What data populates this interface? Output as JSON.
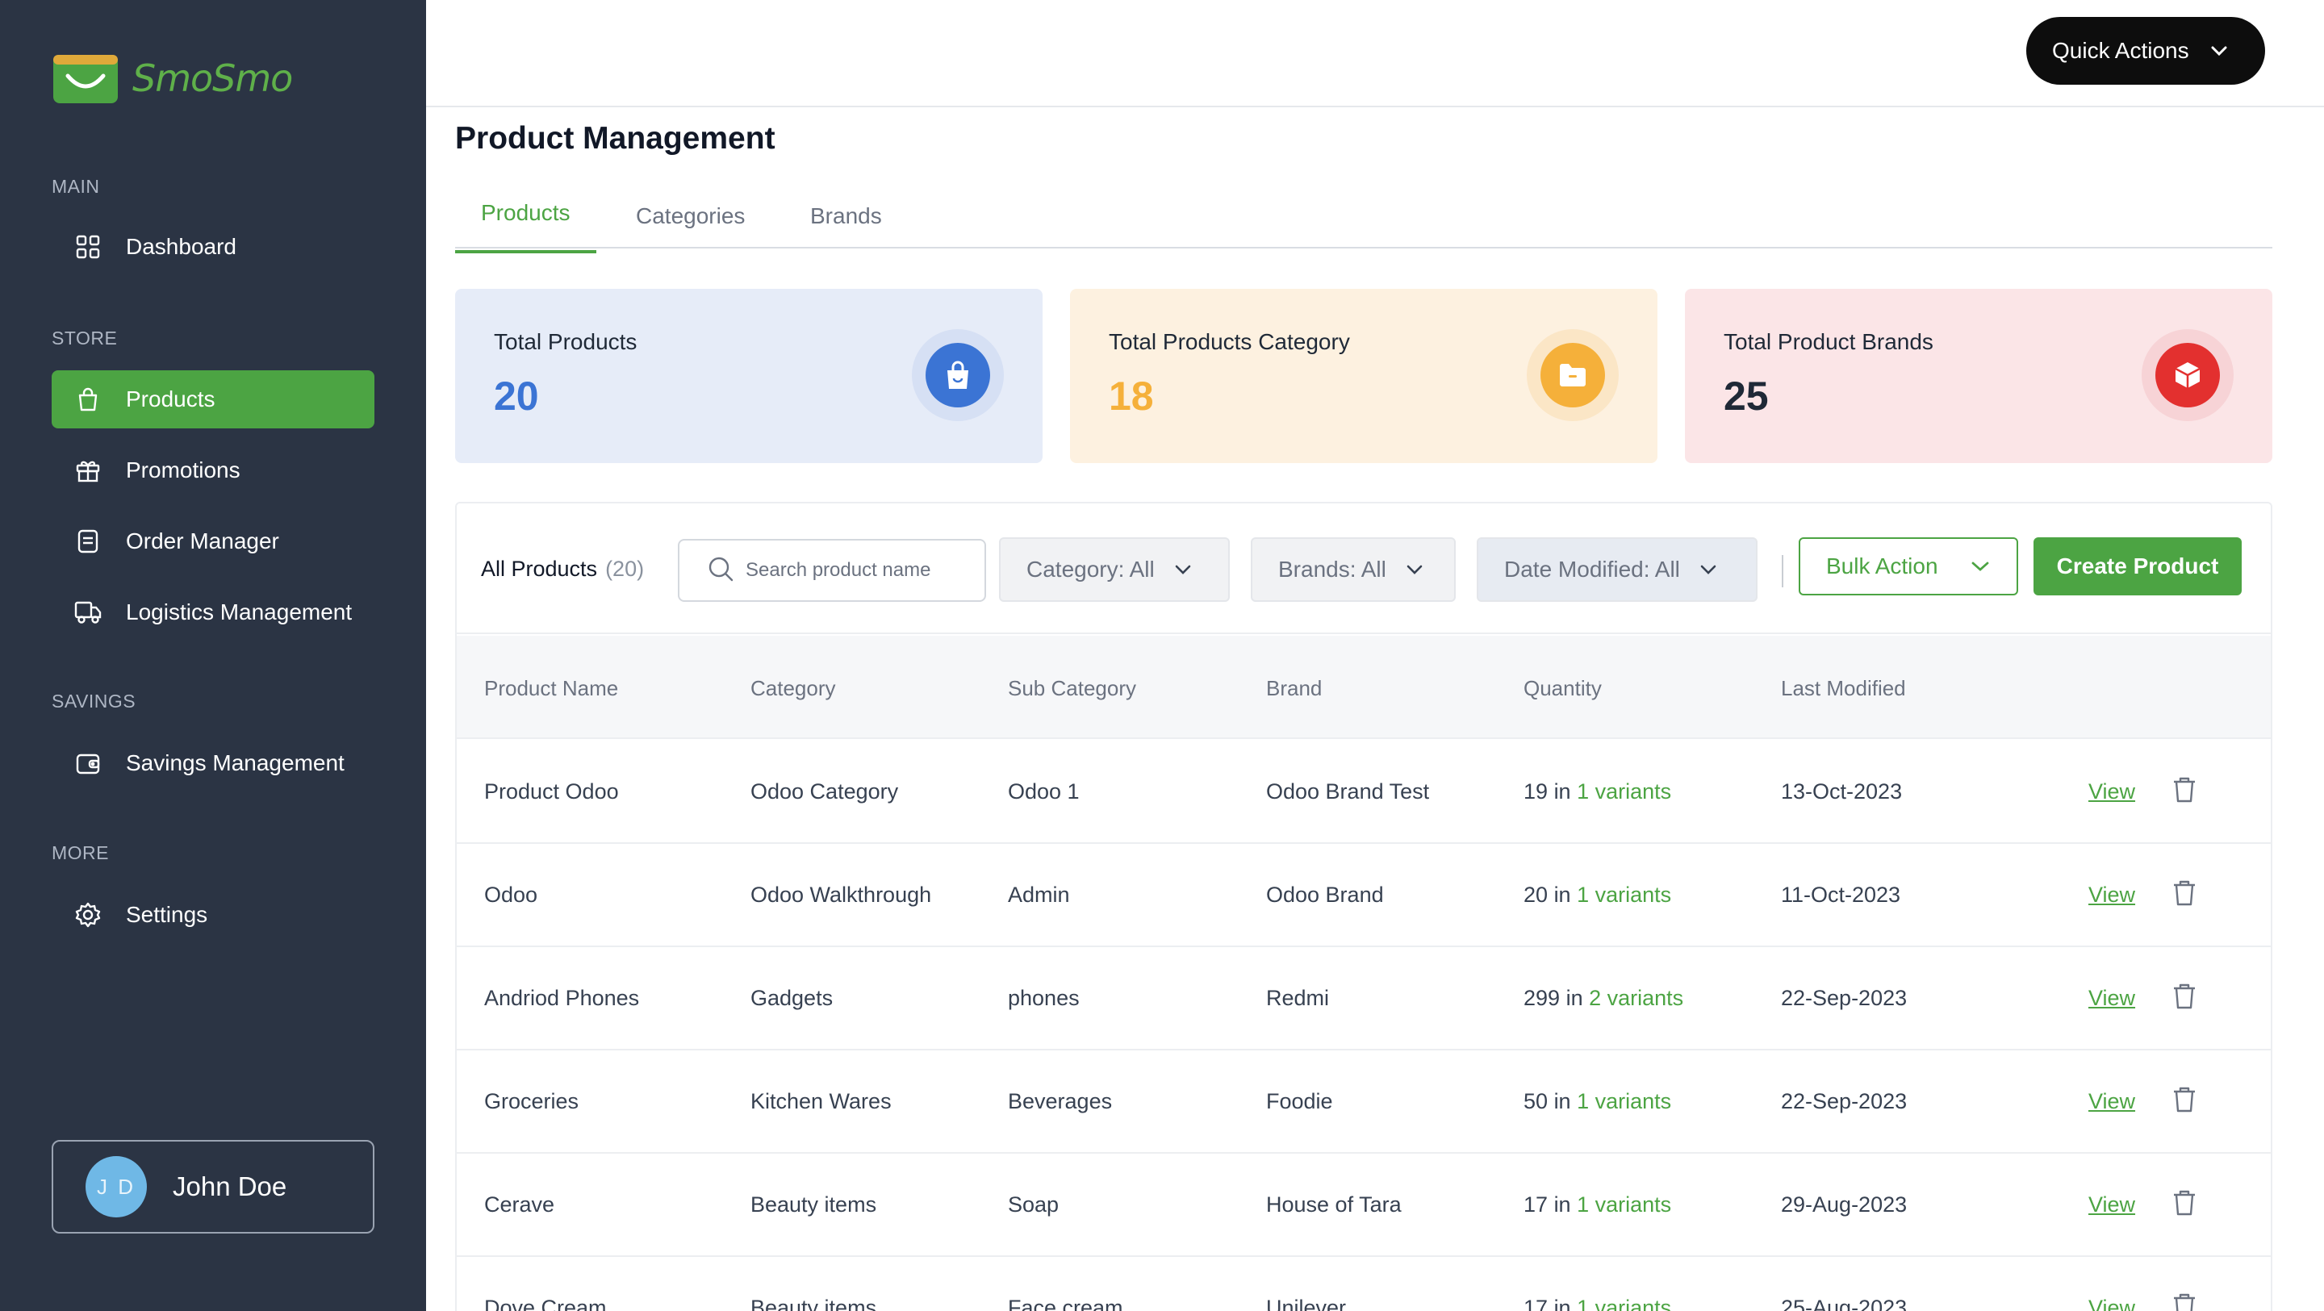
{
  "app": {
    "name": "SmoSmo",
    "brand_color": "#4ca443"
  },
  "sidebar": {
    "sections": [
      {
        "label": "MAIN"
      },
      {
        "label": "STORE"
      },
      {
        "label": "SAVINGS"
      },
      {
        "label": "MORE"
      }
    ],
    "items": [
      {
        "label": "Dashboard",
        "icon": "grid-icon"
      },
      {
        "label": "Products",
        "icon": "shopping-bag-icon",
        "active": true
      },
      {
        "label": "Promotions",
        "icon": "gift-icon"
      },
      {
        "label": "Order Manager",
        "icon": "receipt-icon"
      },
      {
        "label": "Logistics Management",
        "icon": "truck-icon"
      },
      {
        "label": "Savings Management",
        "icon": "wallet-icon"
      },
      {
        "label": "Settings",
        "icon": "gear-icon"
      }
    ],
    "user": {
      "initials": "J D",
      "name": "John Doe"
    }
  },
  "header": {
    "quick_actions_label": "Quick Actions"
  },
  "page": {
    "title": "Product Management",
    "tabs": [
      {
        "label": "Products",
        "active": true
      },
      {
        "label": "Categories"
      },
      {
        "label": "Brands"
      }
    ]
  },
  "stats": [
    {
      "label": "Total Products",
      "value": "20",
      "color": "#3b74d4",
      "bg": "#e6ecf8",
      "icon": "shopping-bag-icon"
    },
    {
      "label": "Total Products Category",
      "value": "18",
      "color": "#f5b03a",
      "bg": "#fdf1e0",
      "icon": "folder-icon"
    },
    {
      "label": "Total Product Brands",
      "value": "25",
      "color": "#1f2937",
      "bg": "#fbe5e7",
      "icon": "box-icon"
    }
  ],
  "table": {
    "title": "All Products",
    "count": "(20)",
    "search_placeholder": "Search product name",
    "filters": {
      "category": "Category: All",
      "brands": "Brands: All",
      "date_modified": "Date Modified: All"
    },
    "bulk_action_label": "Bulk Action",
    "create_label": "Create Product",
    "columns": [
      "Product Name",
      "Category",
      "Sub Category",
      "Brand",
      "Quantity",
      "Last Modified"
    ],
    "view_label": "View",
    "in_label": "in",
    "rows": [
      {
        "name": "Product Odoo",
        "category": "Odoo Category",
        "subcategory": "Odoo 1",
        "brand": "Odoo Brand Test",
        "qty": "19",
        "variants": "1 variants",
        "modified": "13-Oct-2023"
      },
      {
        "name": "Odoo",
        "category": "Odoo Walkthrough",
        "subcategory": "Admin",
        "brand": "Odoo Brand",
        "qty": "20",
        "variants": "1 variants",
        "modified": "11-Oct-2023"
      },
      {
        "name": "Andriod Phones",
        "category": "Gadgets",
        "subcategory": "phones",
        "brand": "Redmi",
        "qty": "299",
        "variants": "2 variants",
        "modified": "22-Sep-2023"
      },
      {
        "name": "Groceries",
        "category": "Kitchen Wares",
        "subcategory": "Beverages",
        "brand": "Foodie",
        "qty": "50",
        "variants": "1 variants",
        "modified": "22-Sep-2023"
      },
      {
        "name": "Cerave",
        "category": "Beauty items",
        "subcategory": "Soap",
        "brand": "House of Tara",
        "qty": "17",
        "variants": "1 variants",
        "modified": "29-Aug-2023"
      },
      {
        "name": "Dove Cream",
        "category": "Beauty items",
        "subcategory": "Face cream",
        "brand": "Unilever",
        "qty": "17",
        "variants": "1 variants",
        "modified": "25-Aug-2023"
      }
    ]
  }
}
